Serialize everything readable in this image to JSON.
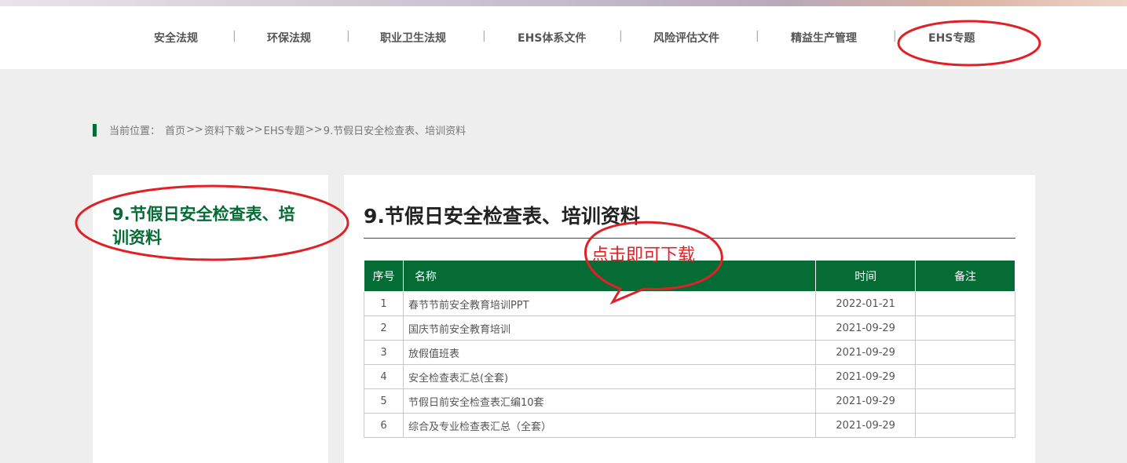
{
  "nav": {
    "items": [
      {
        "label": "安全法规"
      },
      {
        "label": "环保法规"
      },
      {
        "label": "职业卫生法规"
      },
      {
        "label": "EHS体系文件"
      },
      {
        "label": "风险评估文件"
      },
      {
        "label": "精益生产管理"
      },
      {
        "label": "EHS专题"
      }
    ],
    "separator": "|"
  },
  "breadcrumb": {
    "prefix": "当前位置：",
    "items": [
      "首页",
      "资料下载",
      "EHS专题",
      "9.节假日安全检查表、培训资料"
    ],
    "sep": ">>"
  },
  "sidebar": {
    "title": "9.节假日安全检查表、培训资料"
  },
  "main": {
    "title": "9.节假日安全检查表、培训资料",
    "table": {
      "headers": {
        "no": "序号",
        "name": "名称",
        "time": "时间",
        "note": "备注"
      },
      "rows": [
        {
          "no": "1",
          "name": "春节节前安全教育培训PPT",
          "time": "2022-01-21",
          "note": ""
        },
        {
          "no": "2",
          "name": "国庆节前安全教育培训",
          "time": "2021-09-29",
          "note": ""
        },
        {
          "no": "3",
          "name": "放假值班表",
          "time": "2021-09-29",
          "note": ""
        },
        {
          "no": "4",
          "name": "安全检查表汇总(全套)",
          "time": "2021-09-29",
          "note": ""
        },
        {
          "no": "5",
          "name": "节假日前安全检查表汇编10套",
          "time": "2021-09-29",
          "note": ""
        },
        {
          "no": "6",
          "name": "综合及专业检查表汇总（全套）",
          "time": "2021-09-29",
          "note": ""
        }
      ]
    }
  },
  "annotation": {
    "callout_text": "点击即可下载"
  },
  "colors": {
    "brand_green": "#056c36",
    "annotation_red": "#e12026"
  }
}
